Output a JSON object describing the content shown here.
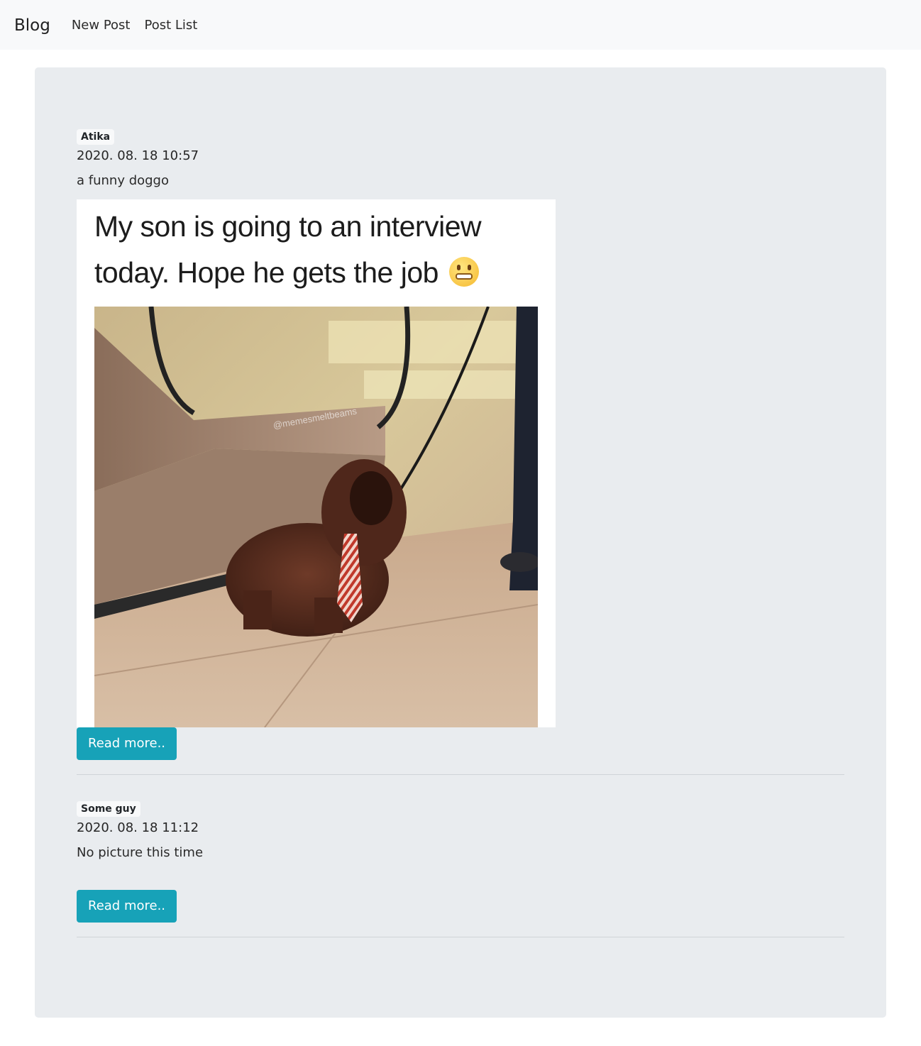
{
  "navbar": {
    "brand": "Blog",
    "links": [
      {
        "label": "New Post"
      },
      {
        "label": "Post List"
      }
    ]
  },
  "posts": [
    {
      "author": "Atika",
      "date": "2020. 08. 18 10:57",
      "text": "a funny doggo",
      "image": {
        "caption_line1": "My son is going to an interview",
        "caption_line2": "today. Hope he gets the job",
        "watermark": "@memesmeltbeams"
      },
      "button_label": "Read more.."
    },
    {
      "author": "Some guy",
      "date": "2020. 08. 18 11:12",
      "text": "No picture this time",
      "button_label": "Read more.."
    }
  ],
  "colors": {
    "navbar_bg": "#f8f9fa",
    "jumbotron_bg": "#e9ecef",
    "button": "#17a2b8"
  }
}
